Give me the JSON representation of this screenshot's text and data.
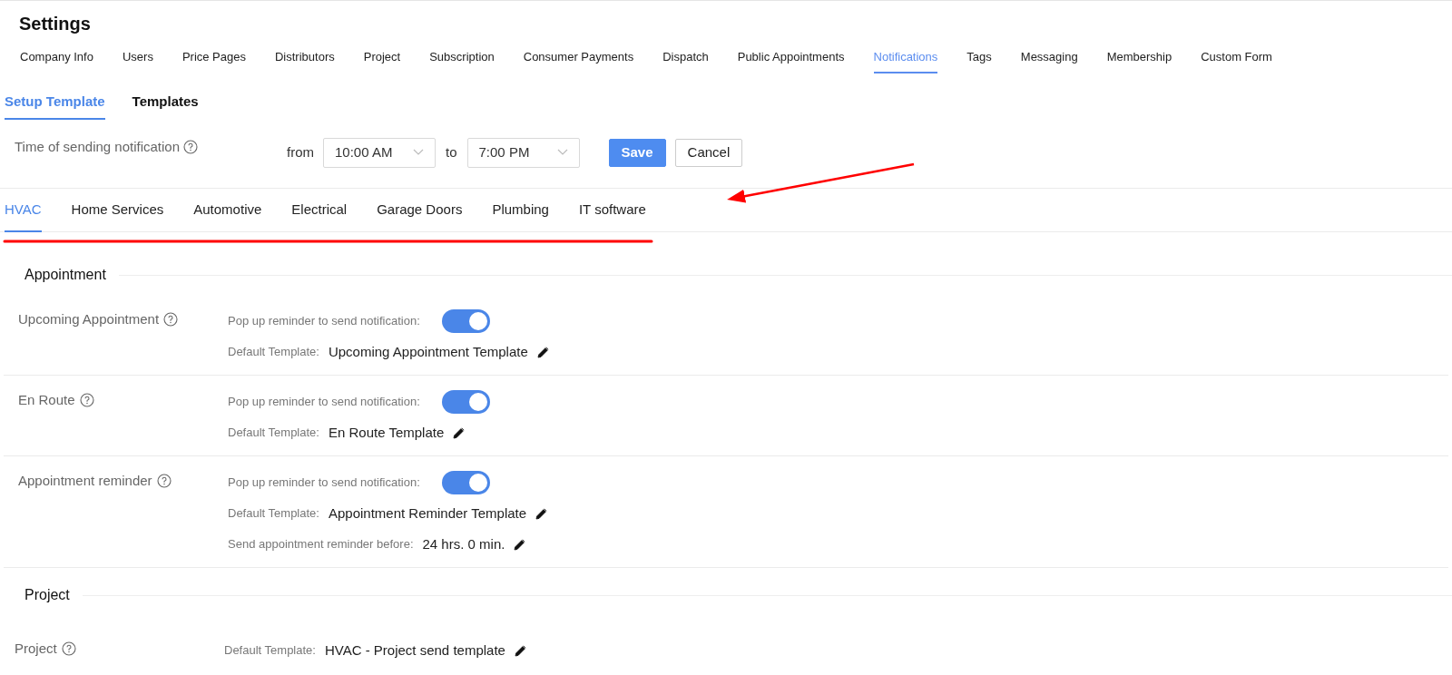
{
  "page_title": "Settings",
  "settings_tabs": [
    {
      "label": "Company Info",
      "selected": false
    },
    {
      "label": "Users",
      "selected": false
    },
    {
      "label": "Price Pages",
      "selected": false
    },
    {
      "label": "Distributors",
      "selected": false
    },
    {
      "label": "Project",
      "selected": false
    },
    {
      "label": "Subscription",
      "selected": false
    },
    {
      "label": "Consumer Payments",
      "selected": false
    },
    {
      "label": "Dispatch",
      "selected": false
    },
    {
      "label": "Public Appointments",
      "selected": false
    },
    {
      "label": "Notifications",
      "selected": true
    },
    {
      "label": "Tags",
      "selected": false
    },
    {
      "label": "Messaging",
      "selected": false
    },
    {
      "label": "Membership",
      "selected": false
    },
    {
      "label": "Custom Form",
      "selected": false
    }
  ],
  "sub_tabs": [
    {
      "label": "Setup Template",
      "selected": true
    },
    {
      "label": "Templates",
      "selected": false
    }
  ],
  "sending_time": {
    "label": "Time of sending notification",
    "from_label": "from",
    "from_value": "10:00 AM",
    "to_label": "to",
    "to_value": "7:00 PM"
  },
  "buttons": [
    {
      "label": "Save",
      "kind": "primary"
    },
    {
      "label": "Cancel",
      "kind": "secondary"
    }
  ],
  "industry_tabs": [
    {
      "label": "HVAC",
      "selected": true
    },
    {
      "label": "Home Services",
      "selected": false
    },
    {
      "label": "Automotive",
      "selected": false
    },
    {
      "label": "Electrical",
      "selected": false
    },
    {
      "label": "Garage Doors",
      "selected": false
    },
    {
      "label": "Plumbing",
      "selected": false
    },
    {
      "label": "IT software",
      "selected": false
    }
  ],
  "sections": [
    {
      "title": "Appointment",
      "rows": [
        {
          "label": "Upcoming Appointment",
          "popup": {
            "label": "Pop up reminder to send notification:",
            "on": true
          },
          "fields": [
            {
              "label": "Default Template:",
              "value": "Upcoming Appointment Template"
            }
          ]
        },
        {
          "label": "En Route",
          "popup": {
            "label": "Pop up reminder to send notification:",
            "on": true
          },
          "fields": [
            {
              "label": "Default Template:",
              "value": "En Route Template"
            }
          ]
        },
        {
          "label": "Appointment reminder",
          "popup": {
            "label": "Pop up reminder to send notification:",
            "on": true
          },
          "fields": [
            {
              "label": "Default Template:",
              "value": "Appointment Reminder Template"
            },
            {
              "label": "Send appointment reminder before:",
              "value": "24 hrs. 0 min."
            }
          ]
        }
      ]
    },
    {
      "title": "Project",
      "rows": [
        {
          "label": "Project",
          "fields": [
            {
              "label": "Default Template:",
              "value": "HVAC - Project send template"
            }
          ]
        }
      ]
    }
  ]
}
